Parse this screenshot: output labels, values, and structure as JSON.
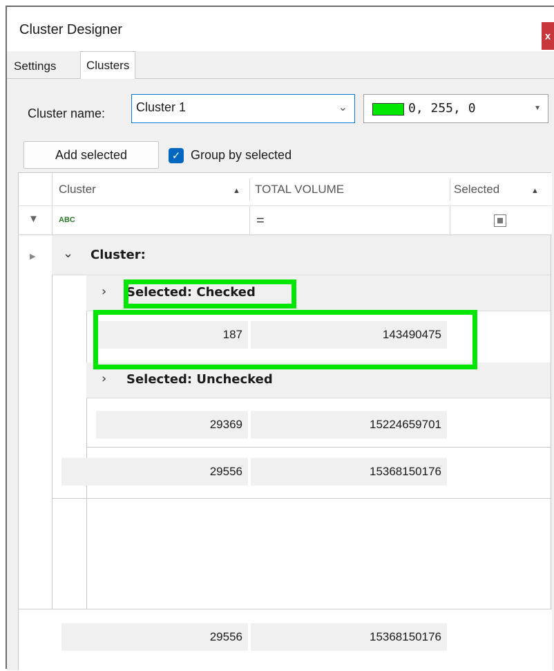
{
  "window": {
    "title": "Cluster Designer",
    "close_label": "x"
  },
  "tabs": [
    {
      "label": "Settings"
    },
    {
      "label": "Clusters"
    }
  ],
  "form": {
    "cluster_name_label": "Cluster name:",
    "cluster_name_value": "Cluster 1",
    "color_value": "0, 255, 0",
    "color_hex": "#00e600",
    "add_selected_label": "Add selected",
    "group_by_selected_label": "Group by selected",
    "group_by_selected_checked": true
  },
  "grid": {
    "columns": [
      {
        "label": "Cluster",
        "sort": "ascending"
      },
      {
        "label": "TOTAL VOLUME"
      },
      {
        "label": "Selected",
        "sort": "ascending"
      }
    ],
    "filter": {
      "cluster": "ABC",
      "total_volume": "="
    },
    "groups": {
      "cluster_label": "Cluster:",
      "checked_label": "Selected: Checked",
      "checked_count": "187",
      "checked_volume": "143490475",
      "unchecked_label": "Selected: Unchecked",
      "unchecked_count": "29369",
      "unchecked_volume": "15224659701",
      "cluster_count": "29556",
      "cluster_volume": "15368150176"
    },
    "footer": {
      "count": "29556",
      "volume": "15368150176"
    }
  }
}
